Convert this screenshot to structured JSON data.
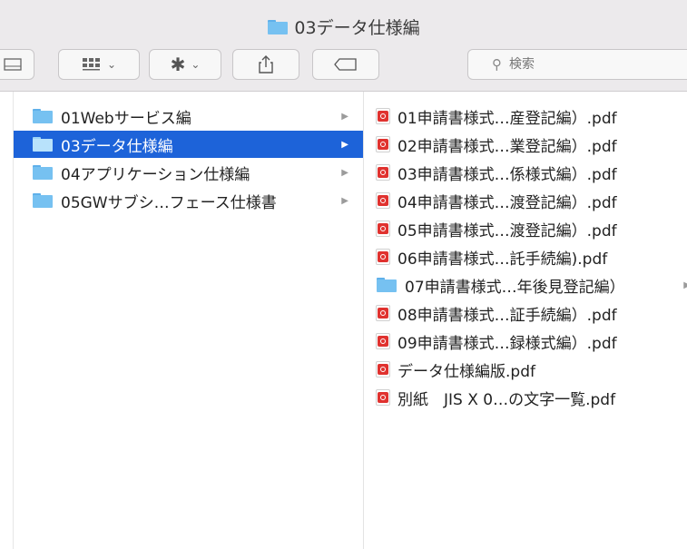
{
  "window": {
    "title": "03データ仕様編"
  },
  "toolbar": {
    "view_icon": "icon-view-grid",
    "action_icon": "gear-icon",
    "share_icon": "share-icon",
    "tag_icon": "tag-icon",
    "search_placeholder": "検索"
  },
  "column1": {
    "items": [
      {
        "label": "01Webサービス編",
        "icon": "folder-icon",
        "selected": false
      },
      {
        "label": "03データ仕様編",
        "icon": "folder-icon",
        "selected": true
      },
      {
        "label": "04アプリケーション仕様編",
        "icon": "folder-icon",
        "selected": false
      },
      {
        "label": "05GWサブシ…フェース仕様書",
        "icon": "folder-icon",
        "selected": false
      }
    ]
  },
  "column2": {
    "items": [
      {
        "label": "01申請書様式…産登記編）.pdf",
        "icon": "pdf-icon"
      },
      {
        "label": "02申請書様式…業登記編）.pdf",
        "icon": "pdf-icon"
      },
      {
        "label": "03申請書様式…係様式編）.pdf",
        "icon": "pdf-icon"
      },
      {
        "label": "04申請書様式…渡登記編）.pdf",
        "icon": "pdf-icon"
      },
      {
        "label": "05申請書様式…渡登記編）.pdf",
        "icon": "pdf-icon"
      },
      {
        "label": "06申請書様式…託手続編).pdf",
        "icon": "pdf-icon"
      },
      {
        "label": "07申請書様式…年後見登記編）",
        "icon": "folder-icon"
      },
      {
        "label": "08申請書様式…証手続編）.pdf",
        "icon": "pdf-icon"
      },
      {
        "label": "09申請書様式…録様式編）.pdf",
        "icon": "pdf-icon"
      },
      {
        "label": "データ仕様編版.pdf",
        "icon": "pdf-icon"
      },
      {
        "label": "別紙　JIS X 0…の文字一覧.pdf",
        "icon": "pdf-icon"
      }
    ]
  },
  "colors": {
    "selection": "#1d63d9",
    "folder": "#76c1f1",
    "pdf": "#e0322f"
  }
}
